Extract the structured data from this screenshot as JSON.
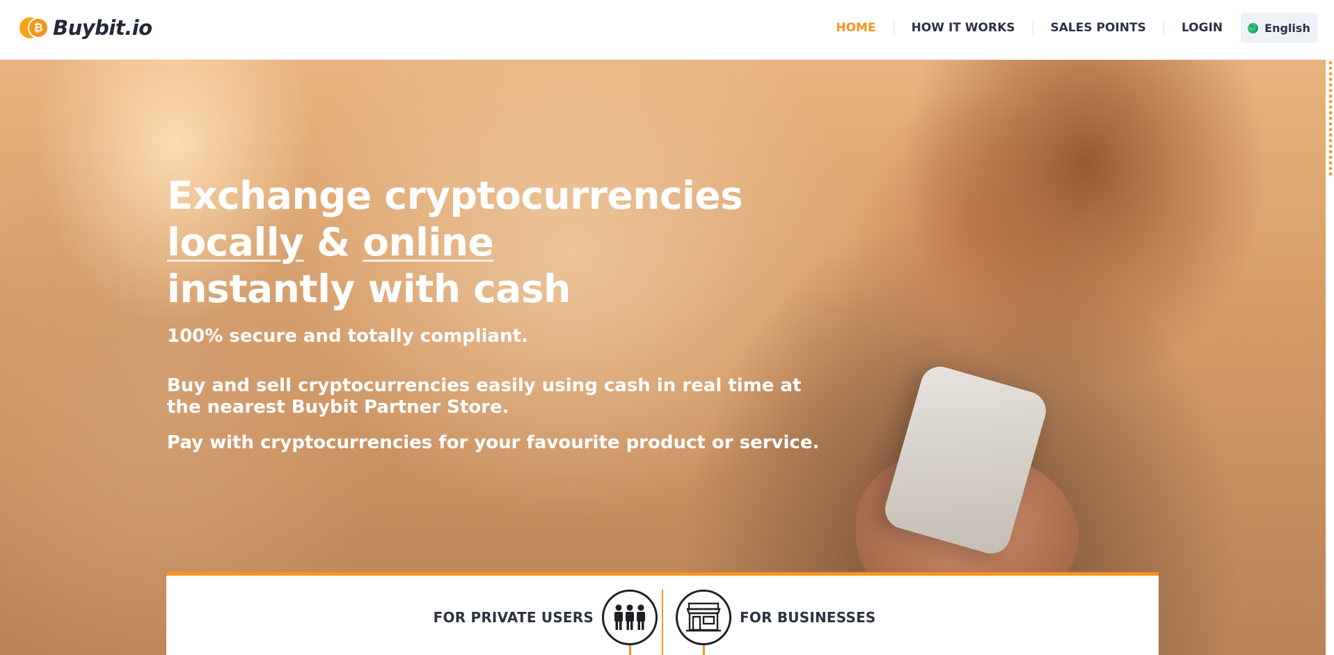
{
  "brand": {
    "name": "Buybit.io",
    "coin_symbol": "₿",
    "accent_color": "#f7941d"
  },
  "nav": {
    "items": [
      {
        "label": "HOME",
        "active": true
      },
      {
        "label": "HOW IT WORKS",
        "active": false
      },
      {
        "label": "SALES POINTS",
        "active": false
      },
      {
        "label": "LOGIN",
        "active": false
      }
    ],
    "language": {
      "label": "English",
      "icon": "globe-icon"
    }
  },
  "hero": {
    "title_line1": "Exchange cryptocurrencies",
    "title_locally": "locally",
    "title_amp": "&",
    "title_online": "online",
    "title_line3": "instantly with cash",
    "subtitle": "100% secure and totally compliant.",
    "paragraph1": "Buy and sell cryptocurrencies easily using cash in real time at the nearest Buybit Partner Store.",
    "paragraph2": "Pay with cryptocurrencies for your favourite product or service."
  },
  "audience": {
    "private_label": "FOR PRIVATE USERS",
    "private_icon": "users-group-icon",
    "business_label": "FOR BUSINESSES",
    "business_icon": "storefront-icon"
  }
}
